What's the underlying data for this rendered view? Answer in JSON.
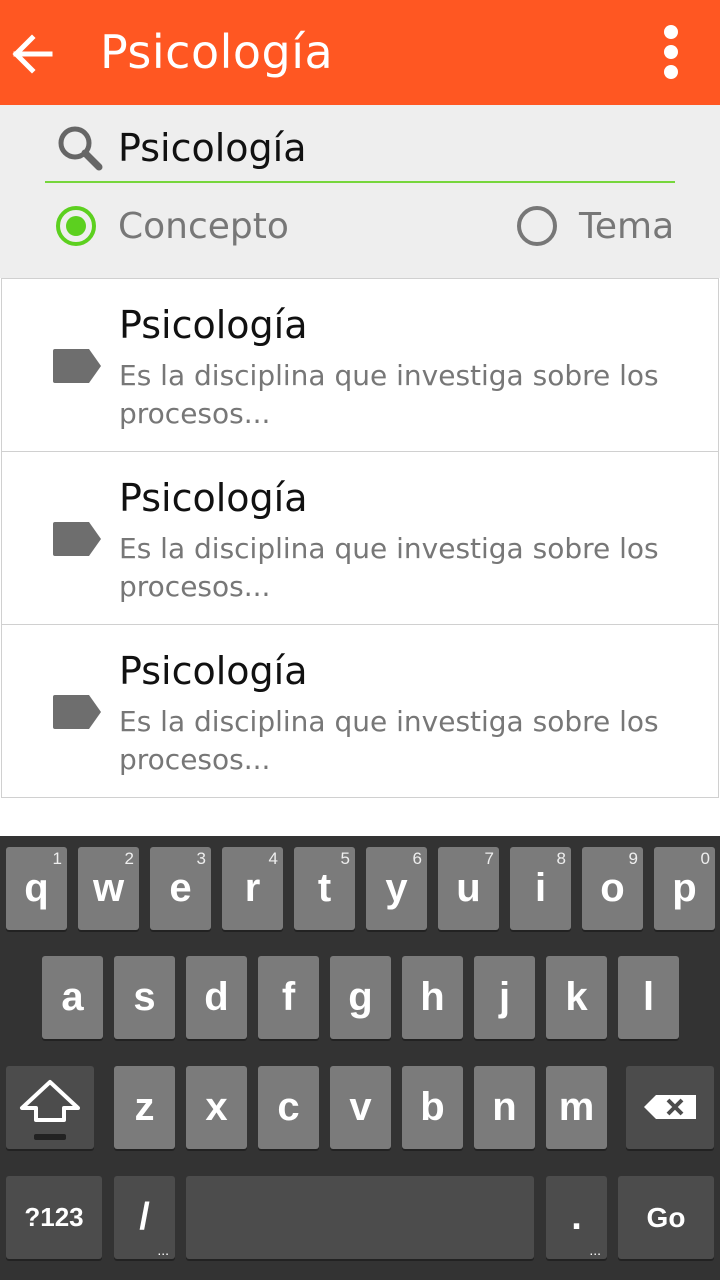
{
  "app_bar": {
    "title": "Psicología",
    "back_icon": "arrow-left-icon",
    "menu_icon": "more-vert-icon",
    "color": "#ff5722"
  },
  "search": {
    "value": "Psicología",
    "icon": "search-icon",
    "underline_color": "#76d63c"
  },
  "filter": {
    "options": [
      {
        "label": "Concepto",
        "selected": true
      },
      {
        "label": "Tema",
        "selected": false
      }
    ],
    "accent": "#5cd01f"
  },
  "results": [
    {
      "title": "Psicología",
      "description": "Es la disciplina que investiga sobre los procesos...",
      "icon": "label-tag-icon"
    },
    {
      "title": "Psicología",
      "description": "Es la disciplina que investiga sobre los procesos...",
      "icon": "label-tag-icon"
    },
    {
      "title": "Psicología",
      "description": "Es la disciplina que investiga sobre los procesos...",
      "icon": "label-tag-icon"
    }
  ],
  "keyboard": {
    "row1": [
      {
        "key": "q",
        "hint": "1"
      },
      {
        "key": "w",
        "hint": "2"
      },
      {
        "key": "e",
        "hint": "3"
      },
      {
        "key": "r",
        "hint": "4"
      },
      {
        "key": "t",
        "hint": "5"
      },
      {
        "key": "y",
        "hint": "6"
      },
      {
        "key": "u",
        "hint": "7"
      },
      {
        "key": "i",
        "hint": "8"
      },
      {
        "key": "o",
        "hint": "9"
      },
      {
        "key": "p",
        "hint": "0"
      }
    ],
    "row2": [
      "a",
      "s",
      "d",
      "f",
      "g",
      "h",
      "j",
      "k",
      "l"
    ],
    "row3": [
      "z",
      "x",
      "c",
      "v",
      "b",
      "n",
      "m"
    ],
    "shift_icon": "shift-arrow-icon",
    "backspace_icon": "backspace-icon",
    "symbols_label": "?123",
    "slash_label": "/",
    "period_label": ".",
    "go_label": "Go",
    "more_hint": "..."
  }
}
